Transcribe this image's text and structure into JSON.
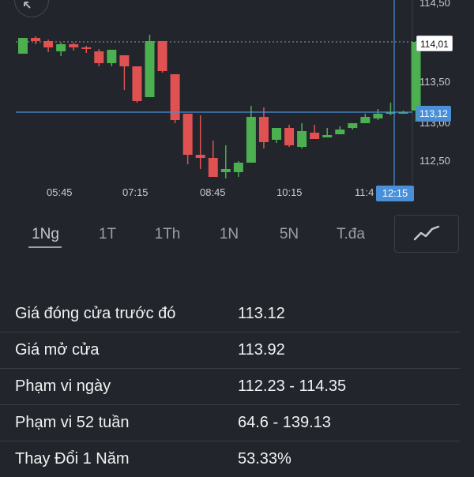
{
  "chart": {
    "y_ticks": [
      "114,50",
      "113,50",
      "113,00",
      "112,50"
    ],
    "x_ticks": [
      "05:45",
      "07:15",
      "08:45",
      "10:15",
      "11:4"
    ],
    "last_price_tag": "114,01",
    "crosshair_price_tag": "113,12",
    "crosshair_time_tag": "12:15",
    "colors": {
      "up": "#4caf50",
      "down": "#e05252",
      "crosshair": "#4a90d9",
      "background": "#22252b"
    }
  },
  "chart_data": {
    "type": "candlestick",
    "y_unit": "price",
    "ylim": [
      112.28,
      114.52
    ],
    "candles": [
      {
        "o": 113.86,
        "h": 114.06,
        "l": 113.88,
        "c": 114.06,
        "dir": "up"
      },
      {
        "o": 114.06,
        "h": 114.08,
        "l": 113.98,
        "c": 114.02,
        "dir": "down"
      },
      {
        "o": 114.02,
        "h": 114.04,
        "l": 113.88,
        "c": 113.94,
        "dir": "down"
      },
      {
        "o": 113.89,
        "h": 114.0,
        "l": 113.83,
        "c": 113.98,
        "dir": "up"
      },
      {
        "o": 113.98,
        "h": 114.0,
        "l": 113.9,
        "c": 113.94,
        "dir": "down"
      },
      {
        "o": 113.94,
        "h": 113.96,
        "l": 113.87,
        "c": 113.92,
        "dir": "down"
      },
      {
        "o": 113.89,
        "h": 113.92,
        "l": 113.7,
        "c": 113.74,
        "dir": "down"
      },
      {
        "o": 113.74,
        "h": 113.91,
        "l": 113.7,
        "c": 113.91,
        "dir": "up"
      },
      {
        "o": 113.84,
        "h": 113.84,
        "l": 113.4,
        "c": 113.7,
        "dir": "down"
      },
      {
        "o": 113.7,
        "h": 113.7,
        "l": 113.24,
        "c": 113.26,
        "dir": "down"
      },
      {
        "o": 113.31,
        "h": 114.1,
        "l": 113.31,
        "c": 114.02,
        "dir": "up"
      },
      {
        "o": 114.02,
        "h": 114.02,
        "l": 113.62,
        "c": 113.64,
        "dir": "down"
      },
      {
        "o": 113.6,
        "h": 113.6,
        "l": 112.98,
        "c": 113.02,
        "dir": "down"
      },
      {
        "o": 113.1,
        "h": 113.08,
        "l": 112.46,
        "c": 112.58,
        "dir": "down"
      },
      {
        "o": 112.58,
        "h": 113.08,
        "l": 112.4,
        "c": 112.54,
        "dir": "down"
      },
      {
        "o": 112.54,
        "h": 112.76,
        "l": 112.34,
        "c": 112.3,
        "dir": "down"
      },
      {
        "o": 112.36,
        "h": 112.7,
        "l": 112.28,
        "c": 112.4,
        "dir": "up"
      },
      {
        "o": 112.36,
        "h": 112.5,
        "l": 112.3,
        "c": 112.48,
        "dir": "up"
      },
      {
        "o": 112.48,
        "h": 113.2,
        "l": 112.48,
        "c": 113.06,
        "dir": "up"
      },
      {
        "o": 113.06,
        "h": 113.18,
        "l": 112.66,
        "c": 112.74,
        "dir": "down"
      },
      {
        "o": 112.77,
        "h": 112.9,
        "l": 112.73,
        "c": 112.92,
        "dir": "up"
      },
      {
        "o": 112.92,
        "h": 112.96,
        "l": 112.68,
        "c": 112.7,
        "dir": "down"
      },
      {
        "o": 112.68,
        "h": 112.98,
        "l": 112.66,
        "c": 112.88,
        "dir": "up"
      },
      {
        "o": 112.86,
        "h": 112.96,
        "l": 112.78,
        "c": 112.78,
        "dir": "down"
      },
      {
        "o": 112.8,
        "h": 112.92,
        "l": 112.8,
        "c": 112.83,
        "dir": "up"
      },
      {
        "o": 112.84,
        "h": 112.94,
        "l": 112.84,
        "c": 112.9,
        "dir": "up"
      },
      {
        "o": 112.92,
        "h": 112.98,
        "l": 112.9,
        "c": 112.98,
        "dir": "up"
      },
      {
        "o": 112.98,
        "h": 113.1,
        "l": 112.98,
        "c": 113.06,
        "dir": "up"
      },
      {
        "o": 113.04,
        "h": 113.16,
        "l": 113.02,
        "c": 113.1,
        "dir": "up"
      },
      {
        "o": 113.1,
        "h": 113.24,
        "l": 113.08,
        "c": 113.12,
        "dir": "up"
      },
      {
        "o": 113.12,
        "h": 113.14,
        "l": 113.12,
        "c": 113.12,
        "dir": "up"
      },
      {
        "o": 113.14,
        "h": 114.02,
        "l": 113.0,
        "c": 114.01,
        "dir": "up"
      }
    ]
  },
  "timeframes": [
    "1Ng",
    "1T",
    "1Th",
    "1N",
    "5N",
    "T.đa"
  ],
  "active_timeframe": "1Ng",
  "chart_type_icon": "line-chart-icon",
  "expand_icon": "expand-icon",
  "stats": [
    {
      "label": "Giá đóng cửa trước đó",
      "value": "113.12"
    },
    {
      "label": "Giá mở cửa",
      "value": "113.92"
    },
    {
      "label": "Phạm vi ngày",
      "value": "112.23 - 114.35"
    },
    {
      "label": "Phạm vi 52 tuần",
      "value": "64.6 - 139.13"
    },
    {
      "label": "Thay Đổi 1 Năm",
      "value": "53.33%"
    }
  ]
}
